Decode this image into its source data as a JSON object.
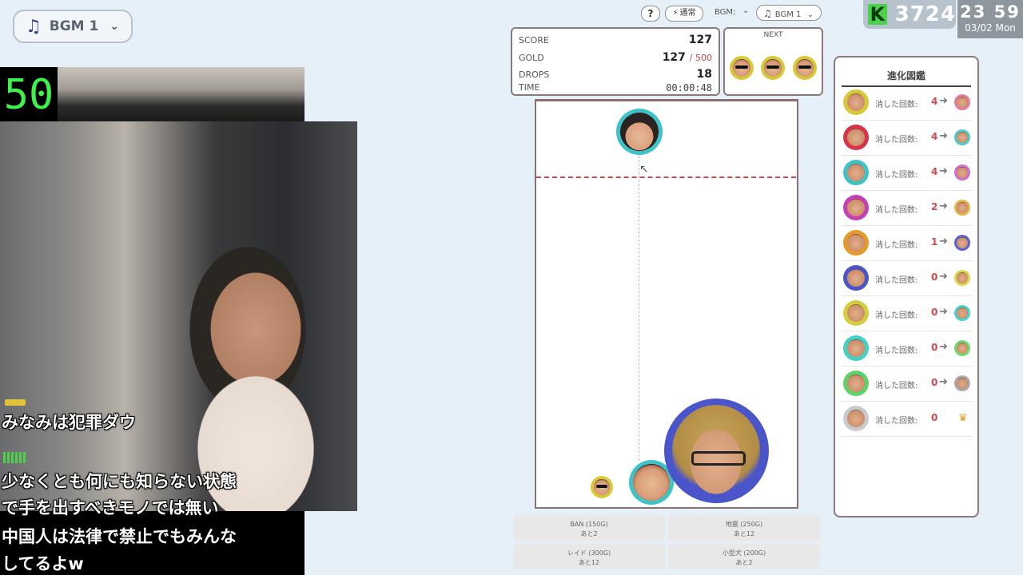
{
  "stream": {
    "bgm_pill_label": "BGM 1",
    "counter": "50",
    "chat": [
      "みなみは犯罪ダウ",
      "少なくとも何にも知らない状態",
      "で手を出すべきモノでは無い",
      "中国人は法律で禁止でもみんな",
      "してるよw"
    ]
  },
  "topbar": {
    "help": "?",
    "mode": "通常",
    "bgm_label": "BGM:",
    "bgm_selected": "BGM 1",
    "coins": "3724",
    "coin_icon": "K",
    "clock_time": "23 59",
    "clock_date": "03/02 Mon"
  },
  "score_panel": {
    "score_label": "SCORE",
    "score": "127",
    "gold_label": "GOLD",
    "gold": "127",
    "gold_max": "/ 500",
    "drops_label": "DROPS",
    "drops": "18",
    "time_label": "TIME",
    "time": "00:00:48"
  },
  "next_panel": {
    "title": "NEXT",
    "pieces": [
      "sunglasses-man",
      "sunglasses-man",
      "sunglasses-man"
    ]
  },
  "items": [
    {
      "name": "BAN (150G)",
      "remaining": "あと2"
    },
    {
      "name": "地震 (250G)",
      "remaining": "あと12"
    },
    {
      "name": "レイド (300G)",
      "remaining": "あと12"
    },
    {
      "name": "小型犬 (200G)",
      "remaining": "あと2"
    }
  ],
  "evolution": {
    "title": "進化図鑑",
    "count_label": "消した回数:",
    "rows": [
      {
        "count": "4",
        "ring": "#d8c93a",
        "next_ring": "#e77ba3"
      },
      {
        "count": "4",
        "ring": "#d9334a",
        "next_ring": "#4ac9cf"
      },
      {
        "count": "4",
        "ring": "#3fc3c9",
        "next_ring": "#d46bd0"
      },
      {
        "count": "2",
        "ring": "#c63fb7",
        "next_ring": "#e6b34a"
      },
      {
        "count": "1",
        "ring": "#e59a2a",
        "next_ring": "#5a63d6"
      },
      {
        "count": "0",
        "ring": "#4a55c9",
        "next_ring": "#d6d94a"
      },
      {
        "count": "0",
        "ring": "#d3cf3f",
        "next_ring": "#4ad2d0"
      },
      {
        "count": "0",
        "ring": "#45d0c4",
        "next_ring": "#6fdc6b"
      },
      {
        "count": "0",
        "ring": "#5ed36a",
        "next_ring": "#a8aab0"
      },
      {
        "count": "0",
        "ring": "#c9cacd",
        "next_ring": "",
        "crown": true
      }
    ]
  },
  "colors": {
    "background": "#e6f0f9",
    "danger_line": "#d9454c",
    "coin_accent": "#4ad24a",
    "counter_green": "#3ff24a"
  }
}
